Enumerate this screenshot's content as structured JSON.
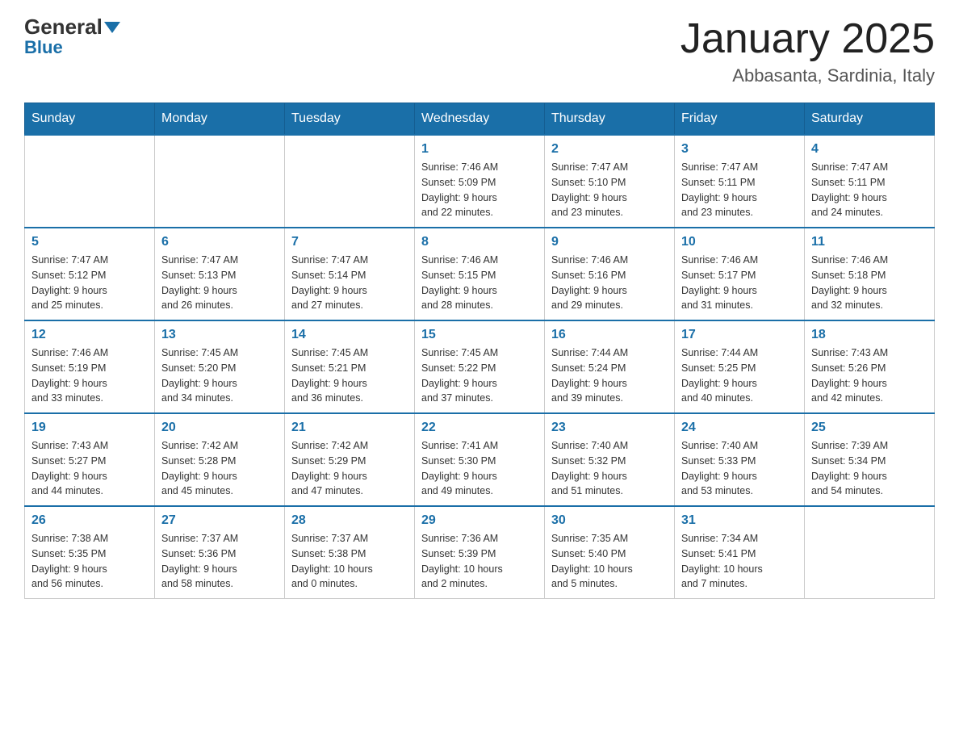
{
  "logo": {
    "general": "General",
    "blue": "Blue"
  },
  "header": {
    "title": "January 2025",
    "subtitle": "Abbasanta, Sardinia, Italy"
  },
  "weekdays": [
    "Sunday",
    "Monday",
    "Tuesday",
    "Wednesday",
    "Thursday",
    "Friday",
    "Saturday"
  ],
  "weeks": [
    [
      {
        "day": "",
        "info": ""
      },
      {
        "day": "",
        "info": ""
      },
      {
        "day": "",
        "info": ""
      },
      {
        "day": "1",
        "info": "Sunrise: 7:46 AM\nSunset: 5:09 PM\nDaylight: 9 hours\nand 22 minutes."
      },
      {
        "day": "2",
        "info": "Sunrise: 7:47 AM\nSunset: 5:10 PM\nDaylight: 9 hours\nand 23 minutes."
      },
      {
        "day": "3",
        "info": "Sunrise: 7:47 AM\nSunset: 5:11 PM\nDaylight: 9 hours\nand 23 minutes."
      },
      {
        "day": "4",
        "info": "Sunrise: 7:47 AM\nSunset: 5:11 PM\nDaylight: 9 hours\nand 24 minutes."
      }
    ],
    [
      {
        "day": "5",
        "info": "Sunrise: 7:47 AM\nSunset: 5:12 PM\nDaylight: 9 hours\nand 25 minutes."
      },
      {
        "day": "6",
        "info": "Sunrise: 7:47 AM\nSunset: 5:13 PM\nDaylight: 9 hours\nand 26 minutes."
      },
      {
        "day": "7",
        "info": "Sunrise: 7:47 AM\nSunset: 5:14 PM\nDaylight: 9 hours\nand 27 minutes."
      },
      {
        "day": "8",
        "info": "Sunrise: 7:46 AM\nSunset: 5:15 PM\nDaylight: 9 hours\nand 28 minutes."
      },
      {
        "day": "9",
        "info": "Sunrise: 7:46 AM\nSunset: 5:16 PM\nDaylight: 9 hours\nand 29 minutes."
      },
      {
        "day": "10",
        "info": "Sunrise: 7:46 AM\nSunset: 5:17 PM\nDaylight: 9 hours\nand 31 minutes."
      },
      {
        "day": "11",
        "info": "Sunrise: 7:46 AM\nSunset: 5:18 PM\nDaylight: 9 hours\nand 32 minutes."
      }
    ],
    [
      {
        "day": "12",
        "info": "Sunrise: 7:46 AM\nSunset: 5:19 PM\nDaylight: 9 hours\nand 33 minutes."
      },
      {
        "day": "13",
        "info": "Sunrise: 7:45 AM\nSunset: 5:20 PM\nDaylight: 9 hours\nand 34 minutes."
      },
      {
        "day": "14",
        "info": "Sunrise: 7:45 AM\nSunset: 5:21 PM\nDaylight: 9 hours\nand 36 minutes."
      },
      {
        "day": "15",
        "info": "Sunrise: 7:45 AM\nSunset: 5:22 PM\nDaylight: 9 hours\nand 37 minutes."
      },
      {
        "day": "16",
        "info": "Sunrise: 7:44 AM\nSunset: 5:24 PM\nDaylight: 9 hours\nand 39 minutes."
      },
      {
        "day": "17",
        "info": "Sunrise: 7:44 AM\nSunset: 5:25 PM\nDaylight: 9 hours\nand 40 minutes."
      },
      {
        "day": "18",
        "info": "Sunrise: 7:43 AM\nSunset: 5:26 PM\nDaylight: 9 hours\nand 42 minutes."
      }
    ],
    [
      {
        "day": "19",
        "info": "Sunrise: 7:43 AM\nSunset: 5:27 PM\nDaylight: 9 hours\nand 44 minutes."
      },
      {
        "day": "20",
        "info": "Sunrise: 7:42 AM\nSunset: 5:28 PM\nDaylight: 9 hours\nand 45 minutes."
      },
      {
        "day": "21",
        "info": "Sunrise: 7:42 AM\nSunset: 5:29 PM\nDaylight: 9 hours\nand 47 minutes."
      },
      {
        "day": "22",
        "info": "Sunrise: 7:41 AM\nSunset: 5:30 PM\nDaylight: 9 hours\nand 49 minutes."
      },
      {
        "day": "23",
        "info": "Sunrise: 7:40 AM\nSunset: 5:32 PM\nDaylight: 9 hours\nand 51 minutes."
      },
      {
        "day": "24",
        "info": "Sunrise: 7:40 AM\nSunset: 5:33 PM\nDaylight: 9 hours\nand 53 minutes."
      },
      {
        "day": "25",
        "info": "Sunrise: 7:39 AM\nSunset: 5:34 PM\nDaylight: 9 hours\nand 54 minutes."
      }
    ],
    [
      {
        "day": "26",
        "info": "Sunrise: 7:38 AM\nSunset: 5:35 PM\nDaylight: 9 hours\nand 56 minutes."
      },
      {
        "day": "27",
        "info": "Sunrise: 7:37 AM\nSunset: 5:36 PM\nDaylight: 9 hours\nand 58 minutes."
      },
      {
        "day": "28",
        "info": "Sunrise: 7:37 AM\nSunset: 5:38 PM\nDaylight: 10 hours\nand 0 minutes."
      },
      {
        "day": "29",
        "info": "Sunrise: 7:36 AM\nSunset: 5:39 PM\nDaylight: 10 hours\nand 2 minutes."
      },
      {
        "day": "30",
        "info": "Sunrise: 7:35 AM\nSunset: 5:40 PM\nDaylight: 10 hours\nand 5 minutes."
      },
      {
        "day": "31",
        "info": "Sunrise: 7:34 AM\nSunset: 5:41 PM\nDaylight: 10 hours\nand 7 minutes."
      },
      {
        "day": "",
        "info": ""
      }
    ]
  ]
}
